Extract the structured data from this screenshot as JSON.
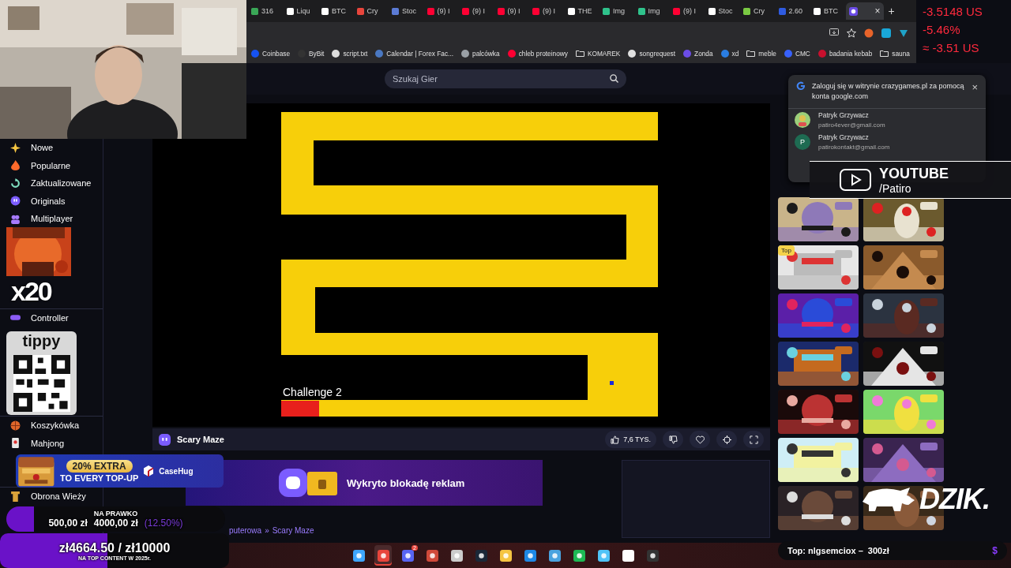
{
  "webcam": {
    "kind": "picture"
  },
  "ticker": [
    "-3.5148 US",
    "-5.46%",
    "≈ -3.51 US"
  ],
  "tabs": [
    {
      "label": "316",
      "selected": false
    },
    {
      "label": "Liqu",
      "selected": false
    },
    {
      "label": "BTC",
      "selected": false
    },
    {
      "label": "Cry",
      "selected": false
    },
    {
      "label": "Stoc",
      "selected": false
    },
    {
      "label": "(9) I",
      "selected": false
    },
    {
      "label": "(9) I",
      "selected": false
    },
    {
      "label": "(9) I",
      "selected": false
    },
    {
      "label": "(9) I",
      "selected": false
    },
    {
      "label": "THE",
      "selected": false
    },
    {
      "label": "Img",
      "selected": false
    },
    {
      "label": "Img",
      "selected": false
    },
    {
      "label": "(9) I",
      "selected": false
    },
    {
      "label": "Stoc",
      "selected": false
    },
    {
      "label": "Cry",
      "selected": false
    },
    {
      "label": "2.60",
      "selected": false
    },
    {
      "label": "BTC",
      "selected": false
    },
    {
      "selected": true,
      "close": "×"
    }
  ],
  "new_tab": "+",
  "bookmarks": [
    {
      "label": "Coinbase",
      "kind": "site"
    },
    {
      "label": "ByBit",
      "kind": "site"
    },
    {
      "label": "script.txt",
      "kind": "site"
    },
    {
      "label": "Calendar | Forex Fac...",
      "kind": "site"
    },
    {
      "label": "palcówka",
      "kind": "site"
    },
    {
      "label": "chleb proteinowy",
      "kind": "site"
    },
    {
      "label": "KOMAREK",
      "kind": "folder"
    },
    {
      "label": "songrequest",
      "kind": "site"
    },
    {
      "label": "Zonda",
      "kind": "site"
    },
    {
      "label": "xd",
      "kind": "site"
    },
    {
      "label": "meble",
      "kind": "folder"
    },
    {
      "label": "CMC",
      "kind": "site"
    },
    {
      "label": "badania kebab",
      "kind": "site"
    },
    {
      "label": "sauna",
      "kind": "folder"
    }
  ],
  "search": {
    "placeholder": "Szukaj Gier"
  },
  "sidebar": {
    "sections": [
      {
        "items": [
          {
            "label": "Nowe"
          },
          {
            "label": "Popularne"
          },
          {
            "label": "Zaktualizowane"
          },
          {
            "label": "Originals"
          },
          {
            "label": "Multiplayer"
          }
        ]
      },
      {
        "items": [
          {
            "label": "Controller"
          }
        ]
      },
      {
        "items": [
          {
            "label": "Koszykówka"
          },
          {
            "label": "Mahjong"
          }
        ]
      },
      {
        "items": [
          {
            "label": "Obrona Wieży"
          }
        ]
      }
    ]
  },
  "game": {
    "title": "Scary Maze",
    "challenge": "Challenge 2",
    "level": 0.1,
    "likes": "7,6 TYS."
  },
  "ad_notice": "Wykryto blokadę reklam",
  "breadcrumb": {
    "parent": "puterowa",
    "separator": "»",
    "current": "Scary Maze"
  },
  "google_prompt": {
    "title": "Zaloguj się w witrynie crazygames.pl za pomocą konta google.com",
    "close": "×",
    "accounts": [
      {
        "name": "Patryk Grzywacz",
        "email": "patiro4ever@gmail.com",
        "kind": "picture"
      },
      {
        "name": "Patryk Grzywacz",
        "email": "patirokontakt@gmail.com",
        "kind": "initial",
        "initial": "P"
      }
    ]
  },
  "thumbnails": [
    {
      "kind": "picture"
    },
    {
      "kind": "picture"
    },
    {
      "kind": "picture",
      "badge": "Top"
    },
    {
      "kind": "picture"
    },
    {
      "kind": "picture"
    },
    {
      "kind": "picture"
    },
    {
      "kind": "picture"
    },
    {
      "kind": "picture"
    },
    {
      "kind": "picture"
    },
    {
      "kind": "picture"
    },
    {
      "kind": "picture"
    },
    {
      "kind": "picture"
    },
    {
      "kind": "picture"
    },
    {
      "kind": "picture"
    }
  ],
  "youtube": {
    "label": "YOUTUBE",
    "handle": "/Patiro"
  },
  "emote": {
    "multiplier": "x20"
  },
  "tippy": {
    "brand": "tippy"
  },
  "casehug": {
    "headline": "20% EXTRA",
    "subline": "TO EVERY TOP-UP",
    "brand": "CaseHug"
  },
  "goals": [
    {
      "kind": "compact",
      "title": "NA PRAWKO",
      "current": "500,00 zł",
      "target": "4000,00 zł",
      "percent": "(12.50%)",
      "level": 0.125
    },
    {
      "kind": "large",
      "title": "zł4664.50 / zł10000",
      "subtitle": "NA TOP CONTENT W 2025r.",
      "level": 0.47
    }
  ],
  "top_donor": {
    "text": "Top: nlgsemciox –  300zł",
    "icon": "$"
  },
  "dzik": {
    "label": "DZIK."
  },
  "taskbar": [
    {
      "selected": false
    },
    {
      "selected": true
    },
    {
      "selected": false,
      "badge": "2"
    },
    {
      "selected": false
    },
    {
      "selected": false
    },
    {
      "selected": false
    },
    {
      "selected": false
    },
    {
      "selected": false
    },
    {
      "selected": false
    },
    {
      "selected": false
    },
    {
      "selected": false
    },
    {
      "selected": false
    },
    {
      "selected": false
    }
  ]
}
